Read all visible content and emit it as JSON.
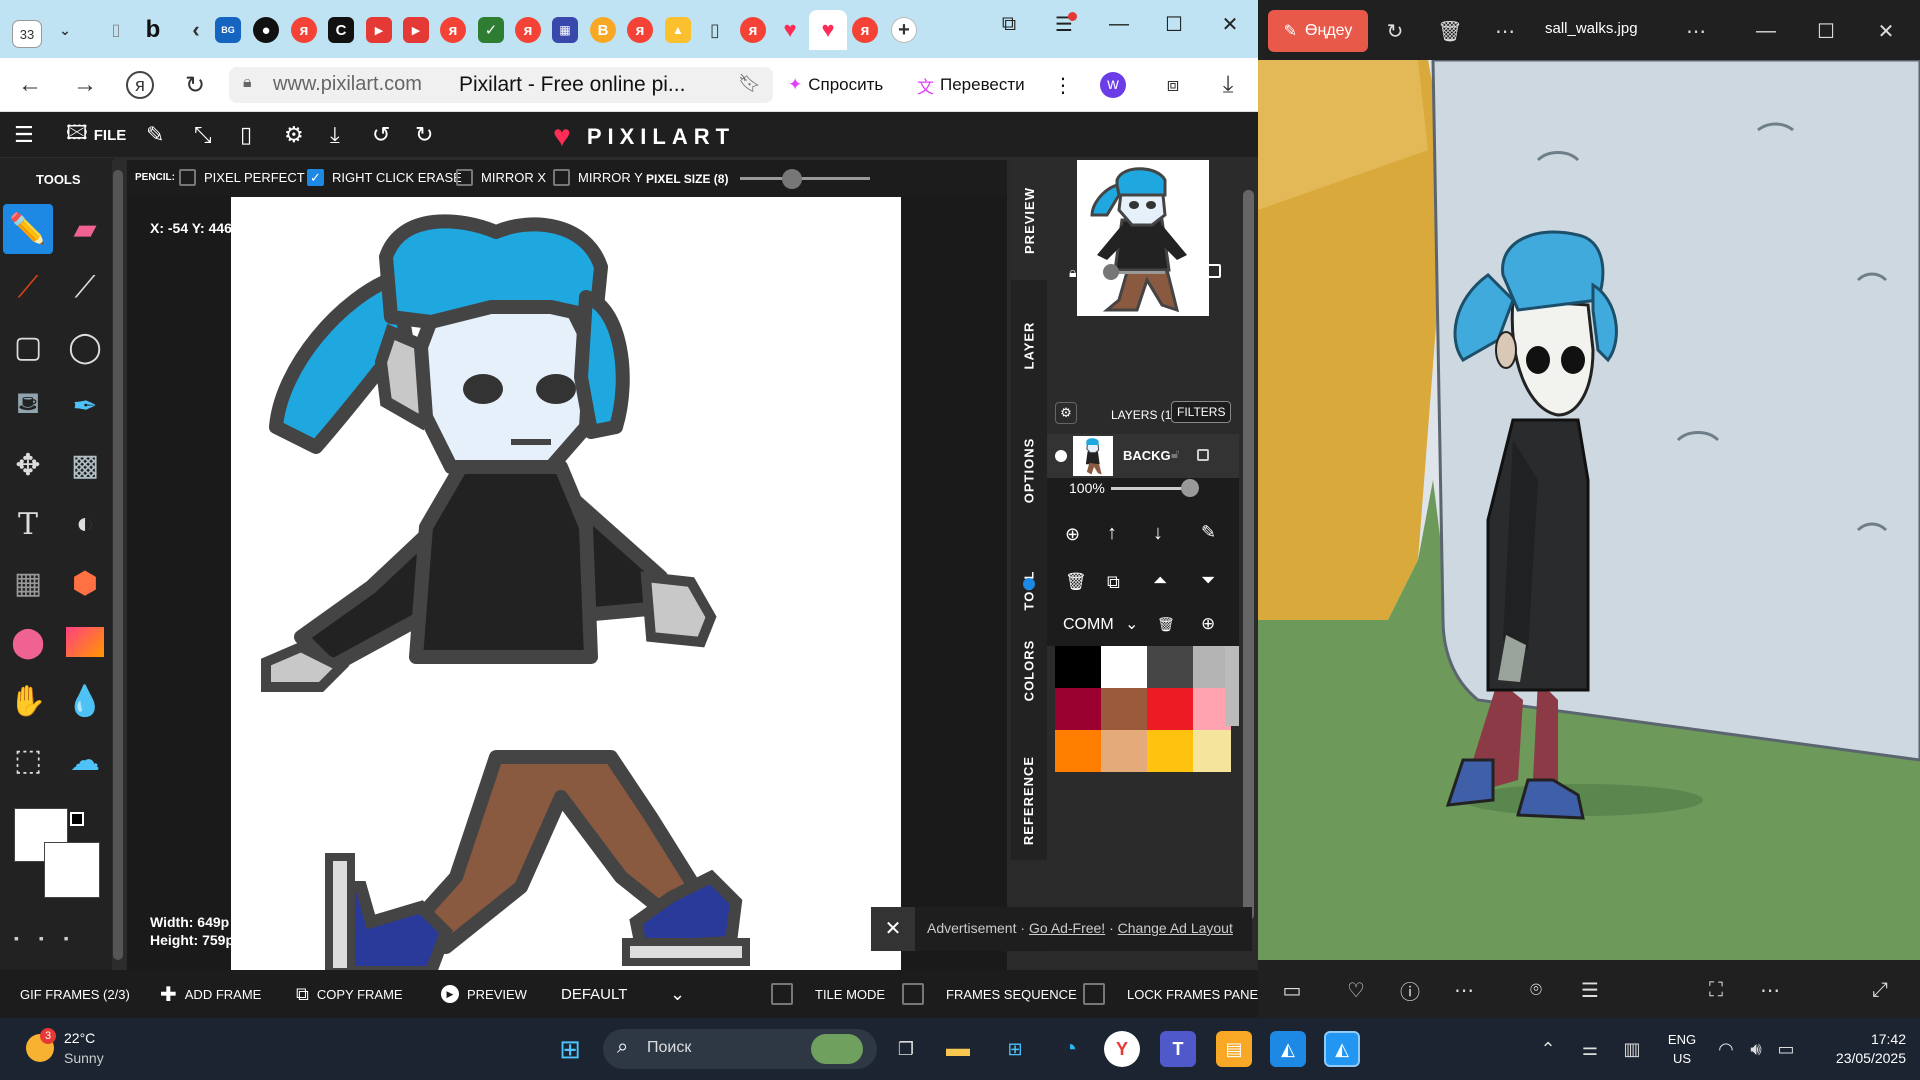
{
  "browser": {
    "tab_count": "33",
    "address": "www.pixilart.com",
    "page_title": "Pixilart - Free online pi...",
    "ask_label": "Спросить",
    "translate_label": "Перевести"
  },
  "pixilart": {
    "file_label": "FILE",
    "logo_text": "PIXILART",
    "tools_title": "TOOLS",
    "options": {
      "pencil_label": "PENCIL:",
      "pixel_perfect": "PIXEL PERFECT",
      "right_click_erase": "RIGHT CLICK ERASE",
      "mirror_x": "MIRROR X",
      "mirror_y": "MIRROR Y",
      "pixel_size": "PIXEL SIZE (8)",
      "right_click_erase_checked": true
    },
    "coords": "X: -54 Y: 446",
    "width_label": "Width: 649p",
    "height_label": "Height: 759p",
    "side_tabs": [
      "PREVIEW",
      "LAYER",
      "OPTIONS",
      "TOOL",
      "COLORS",
      "REFERENCE"
    ],
    "layers_title": "LAYERS (1)",
    "filters_label": "FILTERS",
    "layer_name": "BACKG",
    "opacity": "100%",
    "palette_name": "COMM",
    "palette": [
      "#000000",
      "#ffffff",
      "#464646",
      "#b4b4b4",
      "#990030",
      "#9c5a3c",
      "#ed1c24",
      "#ffa3b1",
      "#ff7e00",
      "#e5aa7a",
      "#ffc20e",
      "#f5e49c"
    ],
    "ad_text": "Advertisement · ",
    "ad_free": "Go Ad-Free!",
    "ad_sep": " · ",
    "change_layout": "Change Ad Layout",
    "bottom": {
      "gif_frames": "GIF FRAMES (2/3)",
      "add_frame": "ADD FRAME",
      "copy_frame": "COPY FRAME",
      "preview": "PREVIEW",
      "default": "DEFAULT",
      "tile_mode": "TILE MODE",
      "frames_sequence": "FRAMES SEQUENCE",
      "lock_frames": "LOCK FRAMES PANEL"
    }
  },
  "photos": {
    "edit_label": "Өңдеу",
    "filename": "sall_walks.jpg"
  },
  "taskbar": {
    "temp": "22°C",
    "weather": "Sunny",
    "weather_badge": "3",
    "search_placeholder": "Поиск",
    "lang1": "ENG",
    "lang2": "US",
    "time": "17:42",
    "date": "23/05/2025"
  },
  "colors": {
    "accent_blue": "#1e88e5",
    "logo_red": "#ff2d55",
    "photos_edit": "#e8594a"
  }
}
